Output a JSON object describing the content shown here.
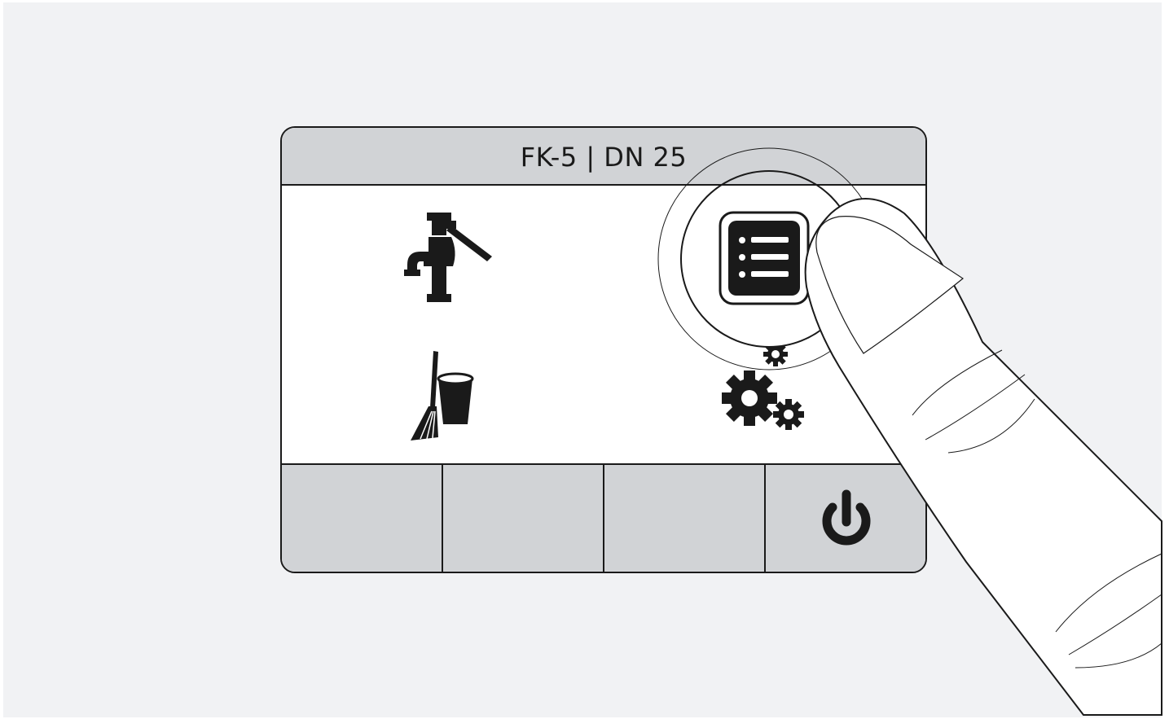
{
  "device": {
    "title": "FK-5 | DN 25"
  },
  "menu": {
    "tiles": [
      {
        "icon": "water-tap-icon"
      },
      {
        "icon": "list-menu-icon",
        "selected": true
      },
      {
        "icon": "cleaning-bucket-broom-icon"
      },
      {
        "icon": "gears-settings-icon"
      }
    ]
  },
  "softkeys": [
    {
      "icon": ""
    },
    {
      "icon": ""
    },
    {
      "icon": ""
    },
    {
      "icon": "power-icon"
    }
  ],
  "colors": {
    "background": "#f1f2f4",
    "bar": "#d1d3d6",
    "ink": "#1a1a1a"
  }
}
